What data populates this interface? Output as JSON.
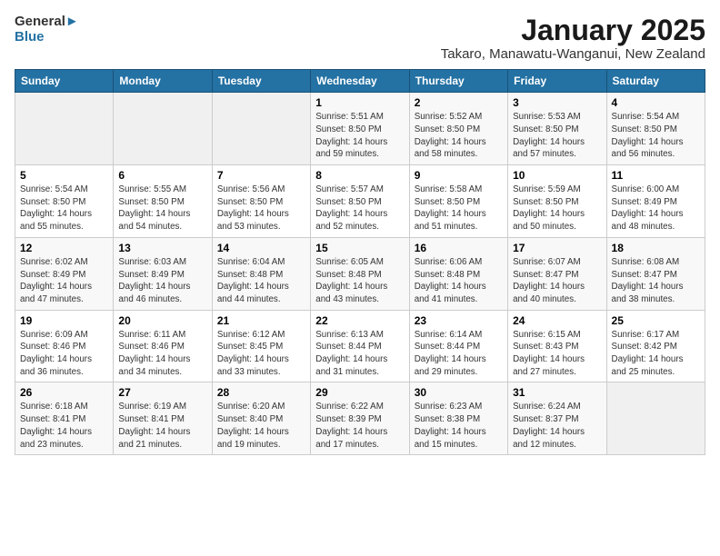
{
  "logo": {
    "general": "General",
    "blue": "Blue"
  },
  "title": "January 2025",
  "subtitle": "Takaro, Manawatu-Wanganui, New Zealand",
  "days_of_week": [
    "Sunday",
    "Monday",
    "Tuesday",
    "Wednesday",
    "Thursday",
    "Friday",
    "Saturday"
  ],
  "weeks": [
    [
      {
        "day": "",
        "info": ""
      },
      {
        "day": "",
        "info": ""
      },
      {
        "day": "",
        "info": ""
      },
      {
        "day": "1",
        "info": "Sunrise: 5:51 AM\nSunset: 8:50 PM\nDaylight: 14 hours\nand 59 minutes."
      },
      {
        "day": "2",
        "info": "Sunrise: 5:52 AM\nSunset: 8:50 PM\nDaylight: 14 hours\nand 58 minutes."
      },
      {
        "day": "3",
        "info": "Sunrise: 5:53 AM\nSunset: 8:50 PM\nDaylight: 14 hours\nand 57 minutes."
      },
      {
        "day": "4",
        "info": "Sunrise: 5:54 AM\nSunset: 8:50 PM\nDaylight: 14 hours\nand 56 minutes."
      }
    ],
    [
      {
        "day": "5",
        "info": "Sunrise: 5:54 AM\nSunset: 8:50 PM\nDaylight: 14 hours\nand 55 minutes."
      },
      {
        "day": "6",
        "info": "Sunrise: 5:55 AM\nSunset: 8:50 PM\nDaylight: 14 hours\nand 54 minutes."
      },
      {
        "day": "7",
        "info": "Sunrise: 5:56 AM\nSunset: 8:50 PM\nDaylight: 14 hours\nand 53 minutes."
      },
      {
        "day": "8",
        "info": "Sunrise: 5:57 AM\nSunset: 8:50 PM\nDaylight: 14 hours\nand 52 minutes."
      },
      {
        "day": "9",
        "info": "Sunrise: 5:58 AM\nSunset: 8:50 PM\nDaylight: 14 hours\nand 51 minutes."
      },
      {
        "day": "10",
        "info": "Sunrise: 5:59 AM\nSunset: 8:50 PM\nDaylight: 14 hours\nand 50 minutes."
      },
      {
        "day": "11",
        "info": "Sunrise: 6:00 AM\nSunset: 8:49 PM\nDaylight: 14 hours\nand 48 minutes."
      }
    ],
    [
      {
        "day": "12",
        "info": "Sunrise: 6:02 AM\nSunset: 8:49 PM\nDaylight: 14 hours\nand 47 minutes."
      },
      {
        "day": "13",
        "info": "Sunrise: 6:03 AM\nSunset: 8:49 PM\nDaylight: 14 hours\nand 46 minutes."
      },
      {
        "day": "14",
        "info": "Sunrise: 6:04 AM\nSunset: 8:48 PM\nDaylight: 14 hours\nand 44 minutes."
      },
      {
        "day": "15",
        "info": "Sunrise: 6:05 AM\nSunset: 8:48 PM\nDaylight: 14 hours\nand 43 minutes."
      },
      {
        "day": "16",
        "info": "Sunrise: 6:06 AM\nSunset: 8:48 PM\nDaylight: 14 hours\nand 41 minutes."
      },
      {
        "day": "17",
        "info": "Sunrise: 6:07 AM\nSunset: 8:47 PM\nDaylight: 14 hours\nand 40 minutes."
      },
      {
        "day": "18",
        "info": "Sunrise: 6:08 AM\nSunset: 8:47 PM\nDaylight: 14 hours\nand 38 minutes."
      }
    ],
    [
      {
        "day": "19",
        "info": "Sunrise: 6:09 AM\nSunset: 8:46 PM\nDaylight: 14 hours\nand 36 minutes."
      },
      {
        "day": "20",
        "info": "Sunrise: 6:11 AM\nSunset: 8:46 PM\nDaylight: 14 hours\nand 34 minutes."
      },
      {
        "day": "21",
        "info": "Sunrise: 6:12 AM\nSunset: 8:45 PM\nDaylight: 14 hours\nand 33 minutes."
      },
      {
        "day": "22",
        "info": "Sunrise: 6:13 AM\nSunset: 8:44 PM\nDaylight: 14 hours\nand 31 minutes."
      },
      {
        "day": "23",
        "info": "Sunrise: 6:14 AM\nSunset: 8:44 PM\nDaylight: 14 hours\nand 29 minutes."
      },
      {
        "day": "24",
        "info": "Sunrise: 6:15 AM\nSunset: 8:43 PM\nDaylight: 14 hours\nand 27 minutes."
      },
      {
        "day": "25",
        "info": "Sunrise: 6:17 AM\nSunset: 8:42 PM\nDaylight: 14 hours\nand 25 minutes."
      }
    ],
    [
      {
        "day": "26",
        "info": "Sunrise: 6:18 AM\nSunset: 8:41 PM\nDaylight: 14 hours\nand 23 minutes."
      },
      {
        "day": "27",
        "info": "Sunrise: 6:19 AM\nSunset: 8:41 PM\nDaylight: 14 hours\nand 21 minutes."
      },
      {
        "day": "28",
        "info": "Sunrise: 6:20 AM\nSunset: 8:40 PM\nDaylight: 14 hours\nand 19 minutes."
      },
      {
        "day": "29",
        "info": "Sunrise: 6:22 AM\nSunset: 8:39 PM\nDaylight: 14 hours\nand 17 minutes."
      },
      {
        "day": "30",
        "info": "Sunrise: 6:23 AM\nSunset: 8:38 PM\nDaylight: 14 hours\nand 15 minutes."
      },
      {
        "day": "31",
        "info": "Sunrise: 6:24 AM\nSunset: 8:37 PM\nDaylight: 14 hours\nand 12 minutes."
      },
      {
        "day": "",
        "info": ""
      }
    ]
  ]
}
